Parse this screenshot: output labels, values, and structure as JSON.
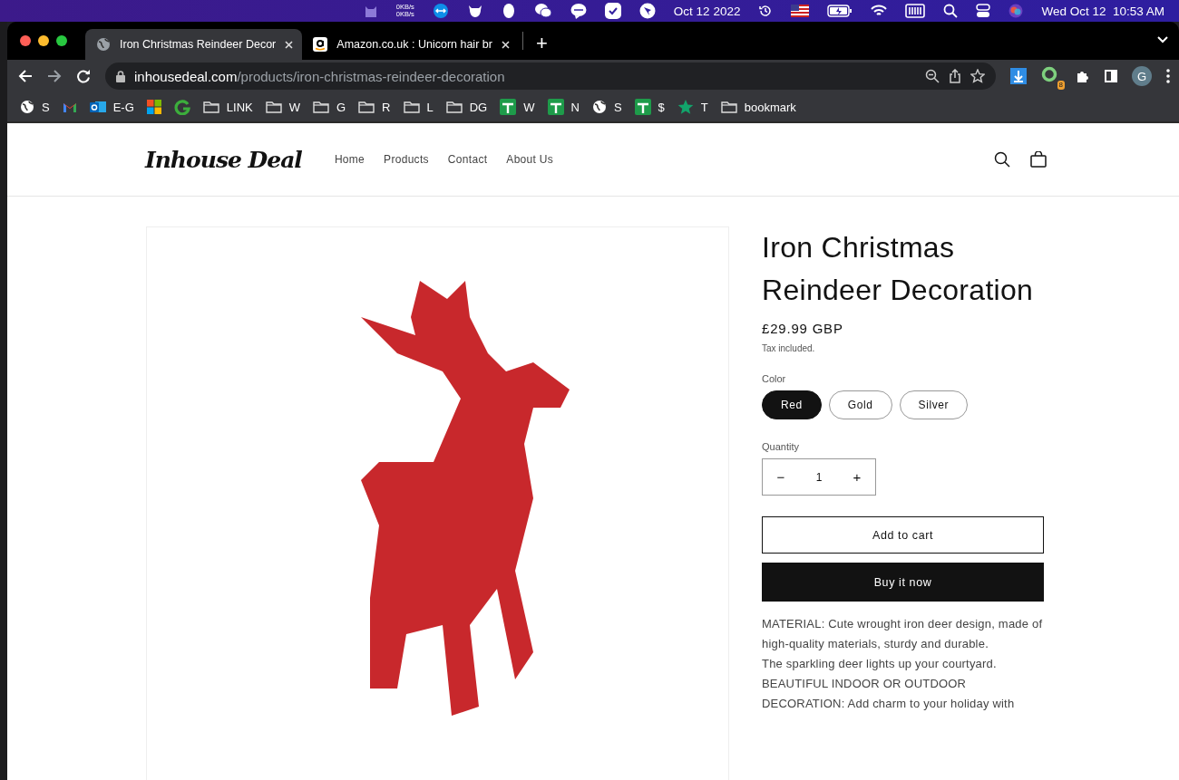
{
  "menu_bar": {
    "net_up": "0KB/s",
    "net_down": "0KB/s",
    "date": "Oct 12 2022",
    "clock": "Wed Oct 12  10:53 AM"
  },
  "tabs": [
    {
      "title": "Iron Christmas Reindeer Decor",
      "kind": "globe",
      "selected": true
    },
    {
      "title": "Amazon.co.uk : Unicorn hair br",
      "kind": "amazon",
      "selected": false
    }
  ],
  "new_tab": "+",
  "address": {
    "domain": "inhousedeal.com",
    "path": "/products/iron-christmas-reindeer-decoration"
  },
  "extension_badge": "8",
  "profile_initial": "G",
  "bookmarks": [
    {
      "kind": "globe",
      "label": "S"
    },
    {
      "kind": "gmail"
    },
    {
      "kind": "outlook",
      "label": "E-G"
    },
    {
      "kind": "windows"
    },
    {
      "kind": "grammarly"
    },
    {
      "kind": "folder",
      "label": "LINK"
    },
    {
      "kind": "folder",
      "label": "W"
    },
    {
      "kind": "folder",
      "label": "G"
    },
    {
      "kind": "folder",
      "label": "R"
    },
    {
      "kind": "folder",
      "label": "L"
    },
    {
      "kind": "folder",
      "label": "DG"
    },
    {
      "kind": "sheets",
      "label": "W"
    },
    {
      "kind": "sheets",
      "label": "N"
    },
    {
      "kind": "globe",
      "label": "S"
    },
    {
      "kind": "sheets",
      "label": "$"
    },
    {
      "kind": "star",
      "label": "T"
    },
    {
      "kind": "folder",
      "label": "bookmark"
    }
  ],
  "store": {
    "logo": "Inhouse Deal",
    "nav": [
      "Home",
      "Products",
      "Contact",
      "About Us"
    ]
  },
  "product": {
    "title": "Iron Christmas Reindeer Decoration",
    "price": "£29.99 GBP",
    "tax_note": "Tax included.",
    "color_label": "Color",
    "colors": [
      {
        "label": "Red",
        "selected": true
      },
      {
        "label": "Gold",
        "selected": false
      },
      {
        "label": "Silver",
        "selected": false
      }
    ],
    "quantity_label": "Quantity",
    "quantity": "1",
    "minus": "−",
    "plus": "+",
    "add_to_cart": "Add to cart",
    "buy_now": "Buy it now",
    "description": [
      "MATERIAL: Cute wrought iron deer design, made of high-quality materials, sturdy and durable.",
      "The sparkling deer lights up your courtyard.",
      "BEAUTIFUL INDOOR OR OUTDOOR",
      "DECORATION: Add charm to your holiday with"
    ]
  }
}
